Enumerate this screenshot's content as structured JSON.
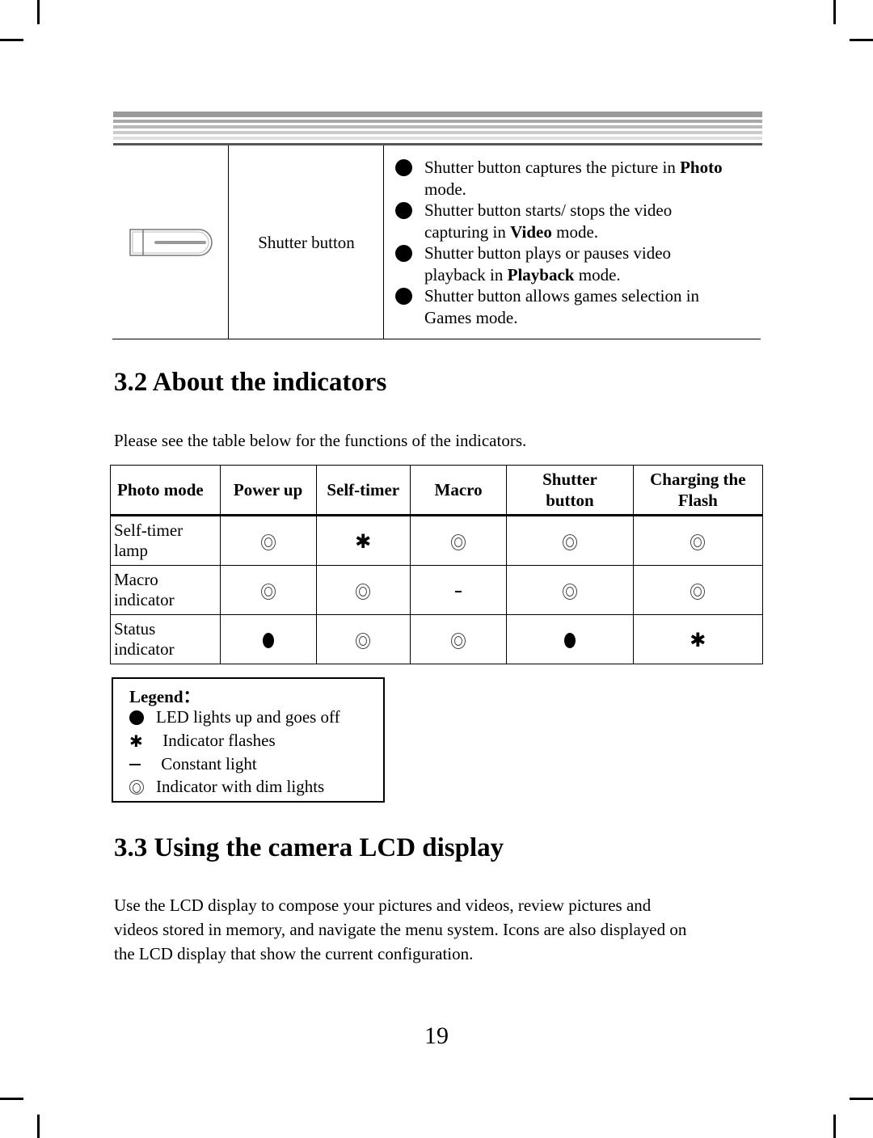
{
  "top_table": {
    "control_name": "Shutter button",
    "bullets": [
      {
        "parts": [
          {
            "t": "Shutter button captures the picture in ",
            "b": false
          },
          {
            "t": "Photo",
            "b": true
          }
        ],
        "line2": [
          {
            "t": "mode.",
            "b": false
          }
        ]
      },
      {
        "parts": [
          {
            "t": "Shutter button starts/ stops the video",
            "b": false
          }
        ],
        "line2": [
          {
            "t": "capturing in ",
            "b": false
          },
          {
            "t": "Video",
            "b": true
          },
          {
            "t": " mode.",
            "b": false
          }
        ]
      },
      {
        "parts": [
          {
            "t": "Shutter button plays or pauses video",
            "b": false
          }
        ],
        "line2": [
          {
            "t": "playback in ",
            "b": false
          },
          {
            "t": "Playback",
            "b": true
          },
          {
            "t": " mode.",
            "b": false
          }
        ]
      },
      {
        "parts": [
          {
            "t": "Shutter button allows games selection in",
            "b": false
          }
        ],
        "line2": [
          {
            "t": "Games mode.",
            "b": false
          }
        ]
      }
    ]
  },
  "section_32": {
    "heading": "3.2 About the indicators",
    "intro": "Please see the table below for the functions of the indicators."
  },
  "indicator_table": {
    "headers": [
      "Photo mode",
      "Power up",
      "Self-timer",
      "Macro",
      "Shutter button",
      "Charging the Flash"
    ],
    "rows": [
      {
        "label": "Self-timer lamp",
        "values": [
          "dim",
          "flash",
          "dim",
          "dim",
          "dim"
        ]
      },
      {
        "label": "Macro indicator",
        "values": [
          "dim",
          "dim",
          "constant",
          "dim",
          "dim"
        ]
      },
      {
        "label": "Status indicator",
        "values": [
          "on_off",
          "dim",
          "dim",
          "on_off",
          "flash"
        ]
      }
    ]
  },
  "legend": {
    "title": "Legend：",
    "items": [
      {
        "symbol": "on_off",
        "icon": "filled-circle-icon",
        "text": "LED lights up and goes off"
      },
      {
        "symbol": "flash",
        "icon": "asterisk-icon",
        "text": " Indicator flashes"
      },
      {
        "symbol": "constant",
        "icon": "dash-icon",
        "text": " Constant light"
      },
      {
        "symbol": "dim",
        "icon": "double-circle-icon",
        "text": "Indicator with dim lights"
      }
    ]
  },
  "section_33": {
    "heading": "3.3 Using the camera LCD display",
    "body_lines": [
      "Use the LCD display to compose your pictures and videos, review pictures and",
      "videos stored in memory, and navigate the menu system. Icons are also displayed on",
      "the LCD display that show the current configuration."
    ]
  },
  "page_number": "19"
}
